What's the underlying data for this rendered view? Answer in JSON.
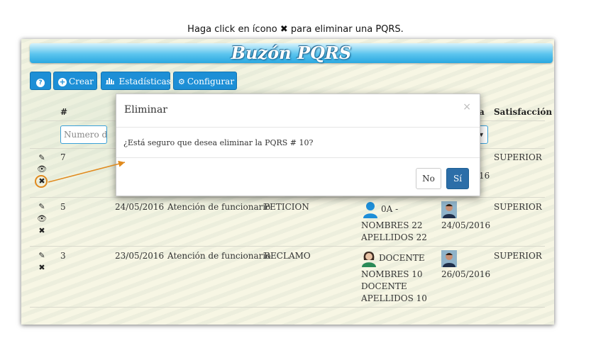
{
  "instruction": {
    "before": "Haga click en ícono ",
    "glyph": "✖",
    "after": " para eliminar una PQRS."
  },
  "header": {
    "title": "Buzón PQRS"
  },
  "toolbar": {
    "help_icon": "?",
    "crear_icon": "+",
    "crear_label": "Crear",
    "estadisticas_icon": "chart-icon",
    "estadisticas_label": "Estadísticas",
    "configurar_icon": "gear-icon",
    "configurar_label": "Configurar"
  },
  "table": {
    "col_number": "#",
    "col_partial": "a",
    "col_satisfaccion": "Satisfacción",
    "filter_placeholder": "Numero d",
    "row1": {
      "number": "7",
      "date_partial": "16",
      "satisfaccion": "SUPERIOR"
    },
    "row2": {
      "number": "5",
      "fecha": "24/05/2016",
      "tipo": "Atención de funcionario",
      "clase": "PETICION",
      "usuario_line1": "0A -",
      "usuario_line2": "NOMBRES 22",
      "usuario_line3": "APELLIDOS 22",
      "fecha2": "24/05/2016",
      "satisfaccion": "SUPERIOR"
    },
    "row3": {
      "number": "3",
      "fecha": "23/05/2016",
      "tipo": "Atención de funcionario",
      "clase": "RECLAMO",
      "usuario_line1": "DOCENTE",
      "usuario_line2": "NOMBRES 10",
      "usuario_line3": "DOCENTE",
      "usuario_line4": "APELLIDOS 10",
      "fecha2": "26/05/2016",
      "satisfaccion": "SUPERIOR"
    }
  },
  "modal": {
    "title": "Eliminar",
    "close": "×",
    "body": "¿Está seguro que desea eliminar la PQRS # 10?",
    "no_label": "No",
    "si_label": "Sí"
  },
  "colors": {
    "accent": "#1d8fd6",
    "highlight": "#e08a1e",
    "confirm": "#2c6ea8"
  }
}
